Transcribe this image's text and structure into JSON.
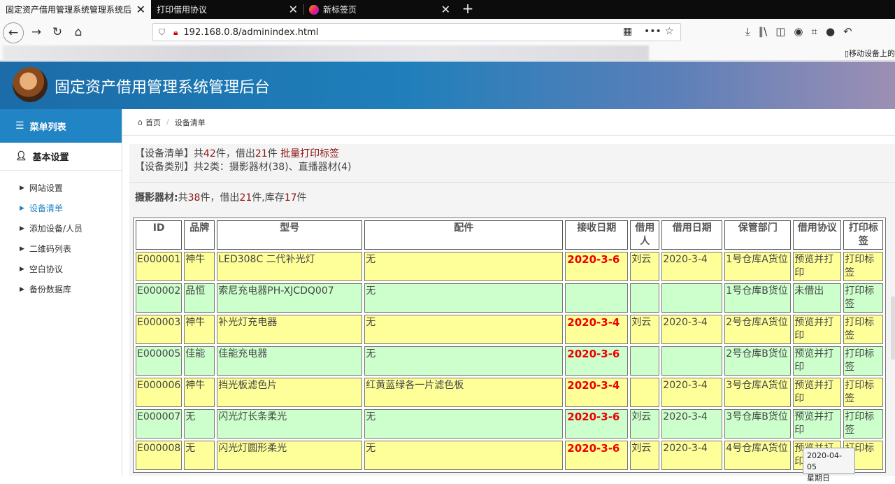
{
  "browser": {
    "tabs": [
      {
        "title": "固定资产借用管理系统管理系统后台"
      },
      {
        "title": "打印借用协议"
      },
      {
        "title": "新标签页"
      }
    ],
    "url": "192.168.0.8/adminindex.html",
    "mobile_label": "移动设备上的"
  },
  "header": {
    "title": "固定资产借用管理系统管理后台"
  },
  "sidebar": {
    "menu_title": "菜单列表",
    "section": "基本设置",
    "items": [
      {
        "label": "网站设置",
        "active": false
      },
      {
        "label": "设备清单",
        "active": true
      },
      {
        "label": "添加设备/人员",
        "active": false
      },
      {
        "label": "二维码列表",
        "active": false
      },
      {
        "label": "空白协议",
        "active": false
      },
      {
        "label": "备份数据库",
        "active": false
      }
    ]
  },
  "breadcrumb": {
    "home": "首页",
    "current": "设备清单"
  },
  "summary": {
    "l1_prefix": "【设备清单】共",
    "total": "42",
    "l1_mid": "件，借出",
    "lent": "21",
    "l1_suffix": "件",
    "batch_print": "批量打印标签",
    "l2": "【设备类别】共2类：摄影器材(38)、直播器材(4)"
  },
  "category": {
    "name": "摄影器材:",
    "p1": "共",
    "total": "38",
    "p2": "件，借出",
    "lent": "21",
    "p3": "件,库存",
    "stock": "17",
    "p4": "件"
  },
  "table": {
    "headers": [
      "ID",
      "品牌",
      "型号",
      "配件",
      "接收日期",
      "借用人",
      "借用日期",
      "保管部门",
      "借用协议",
      "打印标签"
    ],
    "rows": [
      {
        "id": "E000001",
        "brand": "神牛",
        "model": "LED308C 二代补光灯",
        "accessory": "无",
        "recv": "2020-3-6",
        "borrower": "刘云",
        "borrow_date": "2020-3-4",
        "dept": "1号仓库A货位",
        "agreement": "预览并打印",
        "print": "打印标签"
      },
      {
        "id": "E000002",
        "brand": "品恒",
        "model": "索尼充电器PH-XJCDQ007",
        "accessory": "无",
        "recv": "",
        "borrower": "",
        "borrow_date": "",
        "dept": "1号仓库B货位",
        "agreement": "未借出",
        "print": "打印标签"
      },
      {
        "id": "E000003",
        "brand": "神牛",
        "model": "补光灯充电器",
        "accessory": "无",
        "recv": "2020-3-4",
        "borrower": "刘云",
        "borrow_date": "2020-3-4",
        "dept": "2号仓库A货位",
        "agreement": "预览并打印",
        "print": "打印标签"
      },
      {
        "id": "E000005",
        "brand": "佳能",
        "model": "佳能充电器",
        "accessory": "无",
        "recv": "2020-3-6",
        "borrower": "",
        "borrow_date": "",
        "dept": "2号仓库B货位",
        "agreement": "预览并打印",
        "print": "打印标签"
      },
      {
        "id": "E000006",
        "brand": "神牛",
        "model": "挡光板滤色片",
        "accessory": "红黄蓝绿各一片滤色板",
        "recv": "2020-3-4",
        "borrower": "",
        "borrow_date": "2020-3-4",
        "dept": "3号仓库A货位",
        "agreement": "预览并打印",
        "print": "打印标签"
      },
      {
        "id": "E000007",
        "brand": "无",
        "model": "闪光灯长条柔光",
        "accessory": "无",
        "recv": "2020-3-6",
        "borrower": "刘云",
        "borrow_date": "2020-3-4",
        "dept": "3号仓库B货位",
        "agreement": "预览并打印",
        "print": "打印标签"
      },
      {
        "id": "E000008",
        "brand": "无",
        "model": "闪光灯圆形柔光",
        "accessory": "无",
        "recv": "2020-3-6",
        "borrower": "刘云",
        "borrow_date": "2020-3-4",
        "dept": "4号仓库A货位",
        "agreement": "预览并打印",
        "print": "打印标签"
      }
    ]
  },
  "tooltip": {
    "date": "2020-04-05",
    "weekday": "星期日"
  }
}
